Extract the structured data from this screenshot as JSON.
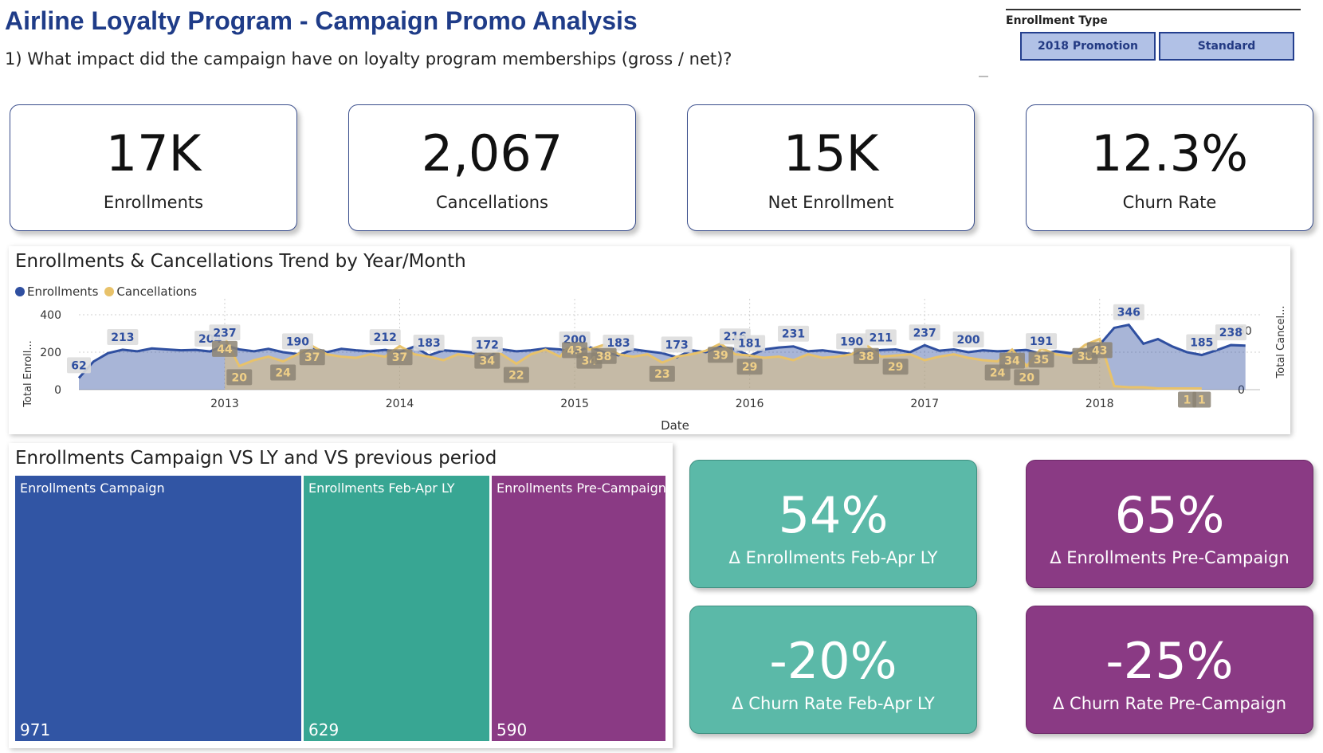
{
  "header": {
    "title": "Airline Loyalty Program - Campaign Promo Analysis",
    "subtitle": "1) What impact did the campaign have on loyalty program memberships (gross / net)?"
  },
  "slicer": {
    "title": "Enrollment Type",
    "options": [
      "2018 Promotion",
      "Standard"
    ]
  },
  "kpis": [
    {
      "value": "17K",
      "label": "Enrollments"
    },
    {
      "value": "2,067",
      "label": "Cancellations"
    },
    {
      "value": "15K",
      "label": "Net Enrollment"
    },
    {
      "value": "12.3%",
      "label": "Churn Rate"
    }
  ],
  "trend": {
    "title": "Enrollments & Cancellations Trend by Year/Month",
    "legend": [
      {
        "name": "Enrollments",
        "color": "#2f4fa0"
      },
      {
        "name": "Cancellations",
        "color": "#e8c26a"
      }
    ],
    "y_left_label": "Total Enroll...",
    "y_right_label": "Total Cancel...",
    "x_label": "Date",
    "y_left_ticks": [
      "400",
      "200",
      "0"
    ],
    "y_right_ticks": [
      "50",
      "0"
    ],
    "x_ticks": [
      "2013",
      "2014",
      "2015",
      "2016",
      "2017",
      "2018"
    ]
  },
  "chart_data": {
    "type": "line",
    "title": "Enrollments & Cancellations Trend by Year/Month",
    "xlabel": "Date",
    "ylabel": "Total Enroll...",
    "ylabel_right": "Total Cancel...",
    "ylim": [
      0,
      400
    ],
    "ylim_right": [
      0,
      50
    ],
    "grid": true,
    "legend_position": "top-left",
    "x_start": "2012-03",
    "x_end": "2018-12",
    "series": [
      {
        "name": "Enrollments",
        "axis": "left",
        "points": [
          [
            "2012-03",
            62
          ],
          [
            "2012-04",
            150
          ],
          [
            "2012-05",
            195
          ],
          [
            "2012-06",
            213
          ],
          [
            "2012-07",
            205
          ],
          [
            "2012-08",
            220
          ],
          [
            "2012-09",
            215
          ],
          [
            "2012-10",
            210
          ],
          [
            "2012-11",
            212
          ],
          [
            "2012-12",
            204
          ],
          [
            "2013-01",
            237
          ],
          [
            "2013-02",
            215
          ],
          [
            "2013-03",
            205
          ],
          [
            "2013-04",
            218
          ],
          [
            "2013-05",
            200
          ],
          [
            "2013-06",
            190
          ],
          [
            "2013-07",
            225
          ],
          [
            "2013-08",
            200
          ],
          [
            "2013-09",
            218
          ],
          [
            "2013-10",
            210
          ],
          [
            "2013-11",
            205
          ],
          [
            "2013-12",
            212
          ],
          [
            "2014-01",
            200
          ],
          [
            "2014-02",
            230
          ],
          [
            "2014-03",
            183
          ],
          [
            "2014-04",
            210
          ],
          [
            "2014-05",
            205
          ],
          [
            "2014-06",
            198
          ],
          [
            "2014-07",
            172
          ],
          [
            "2014-08",
            215
          ],
          [
            "2014-09",
            205
          ],
          [
            "2014-10",
            210
          ],
          [
            "2014-11",
            220
          ],
          [
            "2014-12",
            215
          ],
          [
            "2015-01",
            200
          ],
          [
            "2015-02",
            228
          ],
          [
            "2015-03",
            200
          ],
          [
            "2015-04",
            183
          ],
          [
            "2015-05",
            215
          ],
          [
            "2015-06",
            205
          ],
          [
            "2015-07",
            195
          ],
          [
            "2015-08",
            173
          ],
          [
            "2015-09",
            210
          ],
          [
            "2015-10",
            200
          ],
          [
            "2015-11",
            230
          ],
          [
            "2015-12",
            216
          ],
          [
            "2016-01",
            181
          ],
          [
            "2016-02",
            215
          ],
          [
            "2016-03",
            225
          ],
          [
            "2016-04",
            231
          ],
          [
            "2016-05",
            205
          ],
          [
            "2016-06",
            210
          ],
          [
            "2016-07",
            200
          ],
          [
            "2016-08",
            190
          ],
          [
            "2016-09",
            205
          ],
          [
            "2016-10",
            211
          ],
          [
            "2016-11",
            215
          ],
          [
            "2016-12",
            200
          ],
          [
            "2017-01",
            237
          ],
          [
            "2017-02",
            208
          ],
          [
            "2017-03",
            215
          ],
          [
            "2017-04",
            200
          ],
          [
            "2017-05",
            210
          ],
          [
            "2017-06",
            205
          ],
          [
            "2017-07",
            208
          ],
          [
            "2017-08",
            212
          ],
          [
            "2017-09",
            191
          ],
          [
            "2017-10",
            205
          ],
          [
            "2017-11",
            195
          ],
          [
            "2017-12",
            210
          ],
          [
            "2018-01",
            240
          ],
          [
            "2018-02",
            330
          ],
          [
            "2018-03",
            346
          ],
          [
            "2018-04",
            245
          ],
          [
            "2018-05",
            270
          ],
          [
            "2018-06",
            230
          ],
          [
            "2018-07",
            200
          ],
          [
            "2018-08",
            185
          ],
          [
            "2018-09",
            210
          ],
          [
            "2018-10",
            238
          ],
          [
            "2018-11",
            235
          ]
        ]
      },
      {
        "name": "Cancellations",
        "axis": "right",
        "points": [
          [
            "2013-01",
            44
          ],
          [
            "2013-02",
            20
          ],
          [
            "2013-03",
            25
          ],
          [
            "2013-04",
            28
          ],
          [
            "2013-05",
            24
          ],
          [
            "2013-06",
            30
          ],
          [
            "2013-07",
            37
          ],
          [
            "2013-08",
            30
          ],
          [
            "2013-09",
            28
          ],
          [
            "2013-10",
            27
          ],
          [
            "2013-11",
            30
          ],
          [
            "2013-12",
            28
          ],
          [
            "2014-01",
            37
          ],
          [
            "2014-02",
            30
          ],
          [
            "2014-03",
            28
          ],
          [
            "2014-04",
            25
          ],
          [
            "2014-05",
            30
          ],
          [
            "2014-06",
            28
          ],
          [
            "2014-07",
            34
          ],
          [
            "2014-08",
            30
          ],
          [
            "2014-09",
            22
          ],
          [
            "2014-10",
            30
          ],
          [
            "2014-11",
            34
          ],
          [
            "2014-12",
            28
          ],
          [
            "2015-01",
            43
          ],
          [
            "2015-02",
            34
          ],
          [
            "2015-03",
            38
          ],
          [
            "2015-04",
            30
          ],
          [
            "2015-05",
            28
          ],
          [
            "2015-06",
            30
          ],
          [
            "2015-07",
            23
          ],
          [
            "2015-08",
            28
          ],
          [
            "2015-09",
            30
          ],
          [
            "2015-10",
            33
          ],
          [
            "2015-11",
            39
          ],
          [
            "2015-12",
            30
          ],
          [
            "2016-01",
            29
          ],
          [
            "2016-02",
            27
          ],
          [
            "2016-03",
            28
          ],
          [
            "2016-04",
            25
          ],
          [
            "2016-05",
            30
          ],
          [
            "2016-06",
            27
          ],
          [
            "2016-07",
            28
          ],
          [
            "2016-08",
            30
          ],
          [
            "2016-09",
            38
          ],
          [
            "2016-10",
            28
          ],
          [
            "2016-11",
            29
          ],
          [
            "2016-12",
            30
          ],
          [
            "2017-01",
            25
          ],
          [
            "2017-02",
            28
          ],
          [
            "2017-03",
            30
          ],
          [
            "2017-04",
            27
          ],
          [
            "2017-05",
            25
          ],
          [
            "2017-06",
            24
          ],
          [
            "2017-07",
            34
          ],
          [
            "2017-08",
            20
          ],
          [
            "2017-09",
            35
          ],
          [
            "2017-10",
            30
          ],
          [
            "2017-11",
            28
          ],
          [
            "2017-12",
            38
          ],
          [
            "2018-01",
            43
          ],
          [
            "2018-02",
            3
          ],
          [
            "2018-03",
            2
          ],
          [
            "2018-04",
            2
          ],
          [
            "2018-05",
            1
          ],
          [
            "2018-06",
            1
          ],
          [
            "2018-07",
            1
          ],
          [
            "2018-08",
            1
          ]
        ],
        "labeled": [
          "2013-01",
          "2013-02",
          "2013-05",
          "2013-07",
          "2014-01",
          "2014-07",
          "2014-09",
          "2015-01",
          "2015-02",
          "2015-03",
          "2015-07",
          "2015-11",
          "2016-01",
          "2016-09",
          "2016-11",
          "2017-06",
          "2017-07",
          "2017-08",
          "2017-09",
          "2017-12",
          "2018-01",
          "2018-07",
          "2018-08"
        ]
      }
    ],
    "enroll_labeled": [
      "2012-03",
      "2012-06",
      "2012-12",
      "2013-01",
      "2013-06",
      "2013-12",
      "2014-03",
      "2014-07",
      "2015-01",
      "2015-04",
      "2015-08",
      "2015-12",
      "2016-01",
      "2016-04",
      "2016-08",
      "2016-10",
      "2017-01",
      "2017-04",
      "2017-09",
      "2018-03",
      "2018-08",
      "2018-10"
    ]
  },
  "treemap": {
    "title": "Enrollments Campaign VS LY and VS previous period",
    "items": [
      {
        "label": "Enrollments Campaign",
        "value": 971,
        "color": "#3155a4"
      },
      {
        "label": "Enrollments Feb-Apr LY",
        "value": 629,
        "color": "#38a693"
      },
      {
        "label": "Enrollments Pre-Campaign",
        "value": 590,
        "color": "#8a3a84"
      }
    ]
  },
  "deltas": [
    {
      "value": "54%",
      "label": "Δ Enrollments Feb-Apr LY",
      "color": "#5bb9a8"
    },
    {
      "value": "65%",
      "label": "Δ Enrollments Pre-Campaign",
      "color": "#8a3a84"
    },
    {
      "value": "-20%",
      "label": "Δ Churn Rate Feb-Apr LY",
      "color": "#5bb9a8"
    },
    {
      "value": "-25%",
      "label": "Δ Churn Rate Pre-Campaign",
      "color": "#8a3a84"
    }
  ]
}
